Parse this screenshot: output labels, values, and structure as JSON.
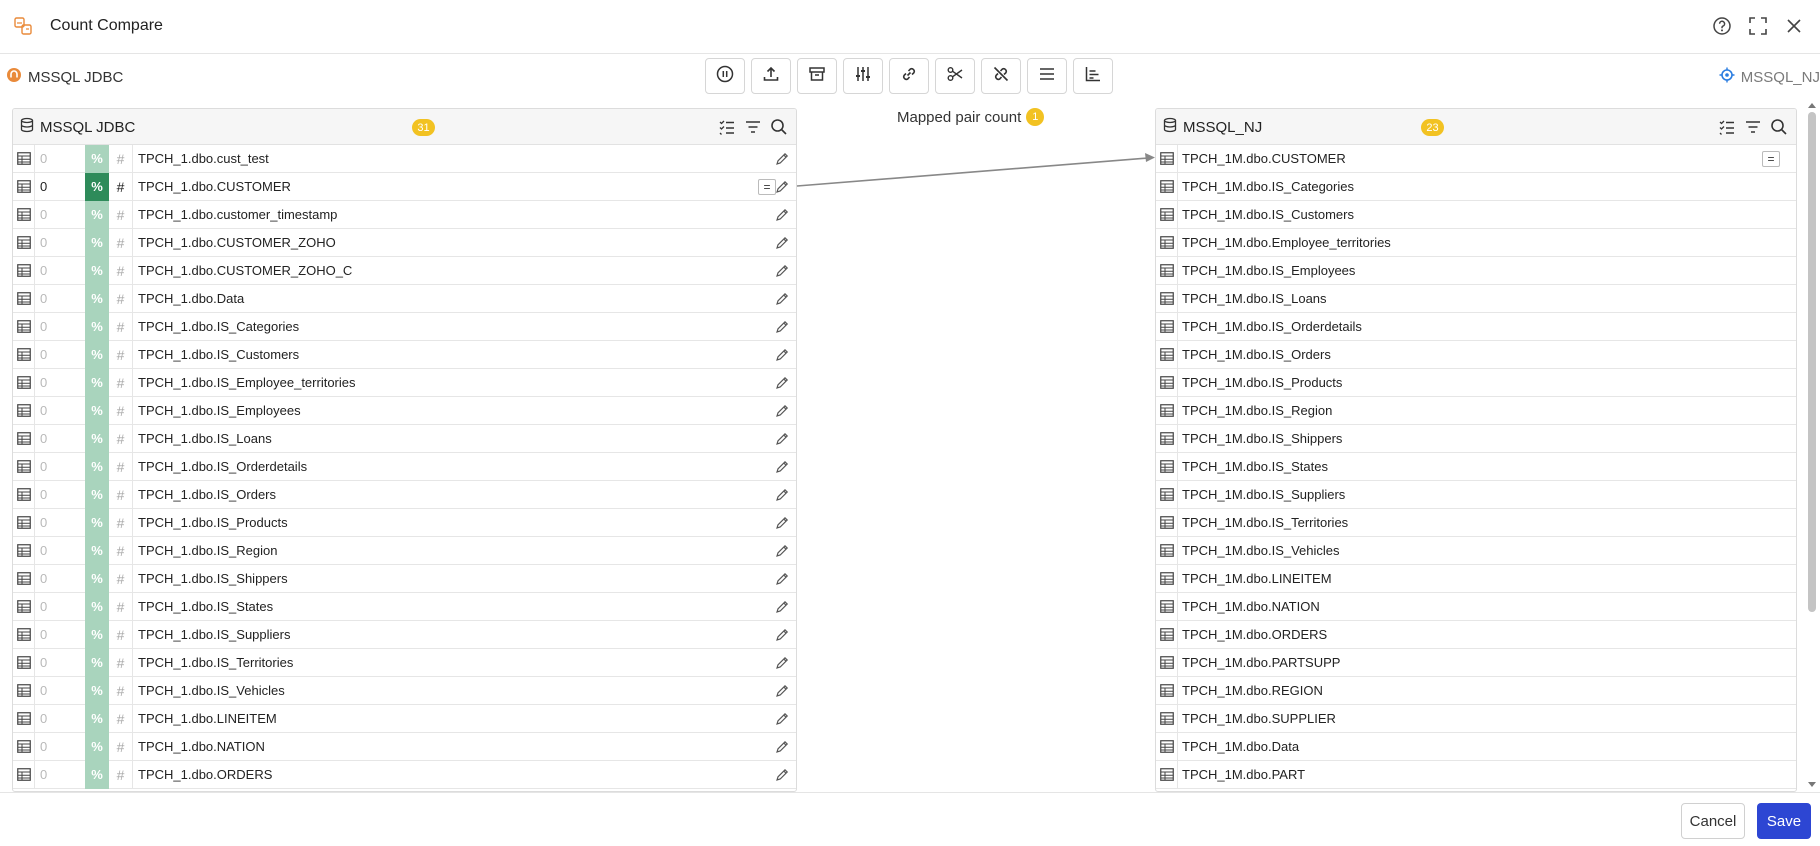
{
  "window": {
    "title": "Count Compare",
    "help_icon": "help-circle-icon",
    "fullscreen_icon": "fullscreen-icon",
    "close_icon": "close-icon"
  },
  "source": {
    "connection": "MSSQL JDBC",
    "count": "31"
  },
  "target": {
    "connection": "MSSQL_NJ",
    "count": "23"
  },
  "toolbar": {
    "buttons": [
      "pause-icon",
      "upload-icon",
      "archive-icon",
      "sliders-icon",
      "link-icon",
      "scissors-icon",
      "unlink-icon",
      "menu-lines-icon",
      "bar-chart-icon"
    ]
  },
  "mapping": {
    "label": "Mapped pair count",
    "count": "1"
  },
  "source_rows": [
    {
      "count": "0",
      "name": "TPCH_1.dbo.cust_test"
    },
    {
      "count": "0",
      "name": "TPCH_1.dbo.CUSTOMER"
    },
    {
      "count": "0",
      "name": "TPCH_1.dbo.customer_timestamp"
    },
    {
      "count": "0",
      "name": "TPCH_1.dbo.CUSTOMER_ZOHO"
    },
    {
      "count": "0",
      "name": "TPCH_1.dbo.CUSTOMER_ZOHO_C"
    },
    {
      "count": "0",
      "name": "TPCH_1.dbo.Data"
    },
    {
      "count": "0",
      "name": "TPCH_1.dbo.IS_Categories"
    },
    {
      "count": "0",
      "name": "TPCH_1.dbo.IS_Customers"
    },
    {
      "count": "0",
      "name": "TPCH_1.dbo.IS_Employee_territories"
    },
    {
      "count": "0",
      "name": "TPCH_1.dbo.IS_Employees"
    },
    {
      "count": "0",
      "name": "TPCH_1.dbo.IS_Loans"
    },
    {
      "count": "0",
      "name": "TPCH_1.dbo.IS_Orderdetails"
    },
    {
      "count": "0",
      "name": "TPCH_1.dbo.IS_Orders"
    },
    {
      "count": "0",
      "name": "TPCH_1.dbo.IS_Products"
    },
    {
      "count": "0",
      "name": "TPCH_1.dbo.IS_Region"
    },
    {
      "count": "0",
      "name": "TPCH_1.dbo.IS_Shippers"
    },
    {
      "count": "0",
      "name": "TPCH_1.dbo.IS_States"
    },
    {
      "count": "0",
      "name": "TPCH_1.dbo.IS_Suppliers"
    },
    {
      "count": "0",
      "name": "TPCH_1.dbo.IS_Territories"
    },
    {
      "count": "0",
      "name": "TPCH_1.dbo.IS_Vehicles"
    },
    {
      "count": "0",
      "name": "TPCH_1.dbo.LINEITEM"
    },
    {
      "count": "0",
      "name": "TPCH_1.dbo.NATION"
    },
    {
      "count": "0",
      "name": "TPCH_1.dbo.ORDERS"
    }
  ],
  "target_rows": [
    "TPCH_1M.dbo.CUSTOMER",
    "TPCH_1M.dbo.IS_Categories",
    "TPCH_1M.dbo.IS_Customers",
    "TPCH_1M.dbo.Employee_territories",
    "TPCH_1M.dbo.IS_Employees",
    "TPCH_1M.dbo.IS_Loans",
    "TPCH_1M.dbo.IS_Orderdetails",
    "TPCH_1M.dbo.IS_Orders",
    "TPCH_1M.dbo.IS_Products",
    "TPCH_1M.dbo.IS_Region",
    "TPCH_1M.dbo.IS_Shippers",
    "TPCH_1M.dbo.IS_States",
    "TPCH_1M.dbo.IS_Suppliers",
    "TPCH_1M.dbo.IS_Territories",
    "TPCH_1M.dbo.IS_Vehicles",
    "TPCH_1M.dbo.LINEITEM",
    "TPCH_1M.dbo.NATION",
    "TPCH_1M.dbo.ORDERS",
    "TPCH_1M.dbo.PARTSUPP",
    "TPCH_1M.dbo.REGION",
    "TPCH_1M.dbo.SUPPLIER",
    "TPCH_1M.dbo.Data",
    "TPCH_1M.dbo.PART"
  ],
  "row_symbols": {
    "percent": "%",
    "hash": "#",
    "equals": "="
  },
  "footer": {
    "cancel_label": "Cancel",
    "save_label": "Save"
  },
  "colors": {
    "accent": "#2d46d3",
    "badge": "#f2c222",
    "pct_light": "#a9d4bd",
    "pct_active": "#2e8b5a",
    "app_icon": "#e98a3a",
    "target_icon": "#2b7de0"
  }
}
